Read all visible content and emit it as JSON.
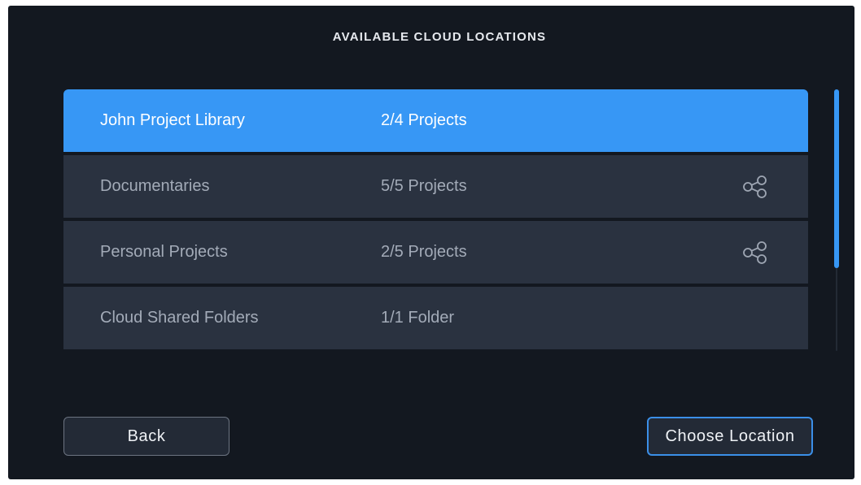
{
  "dialog": {
    "title": "AVAILABLE CLOUD LOCATIONS"
  },
  "locations": [
    {
      "name": "John Project Library",
      "count": "2/4 Projects",
      "shared": false,
      "selected": true
    },
    {
      "name": "Documentaries",
      "count": "5/5 Projects",
      "shared": true,
      "selected": false
    },
    {
      "name": "Personal Projects",
      "count": "2/5 Projects",
      "shared": true,
      "selected": false
    },
    {
      "name": "Cloud Shared Folders",
      "count": "1/1 Folder",
      "shared": false,
      "selected": false
    }
  ],
  "icons": {
    "shared": "share-icon"
  },
  "buttons": {
    "back_label": "Back",
    "choose_label": "Choose Location"
  },
  "colors": {
    "accent": "#3797f5",
    "background": "#131820",
    "row": "#2a3240"
  }
}
